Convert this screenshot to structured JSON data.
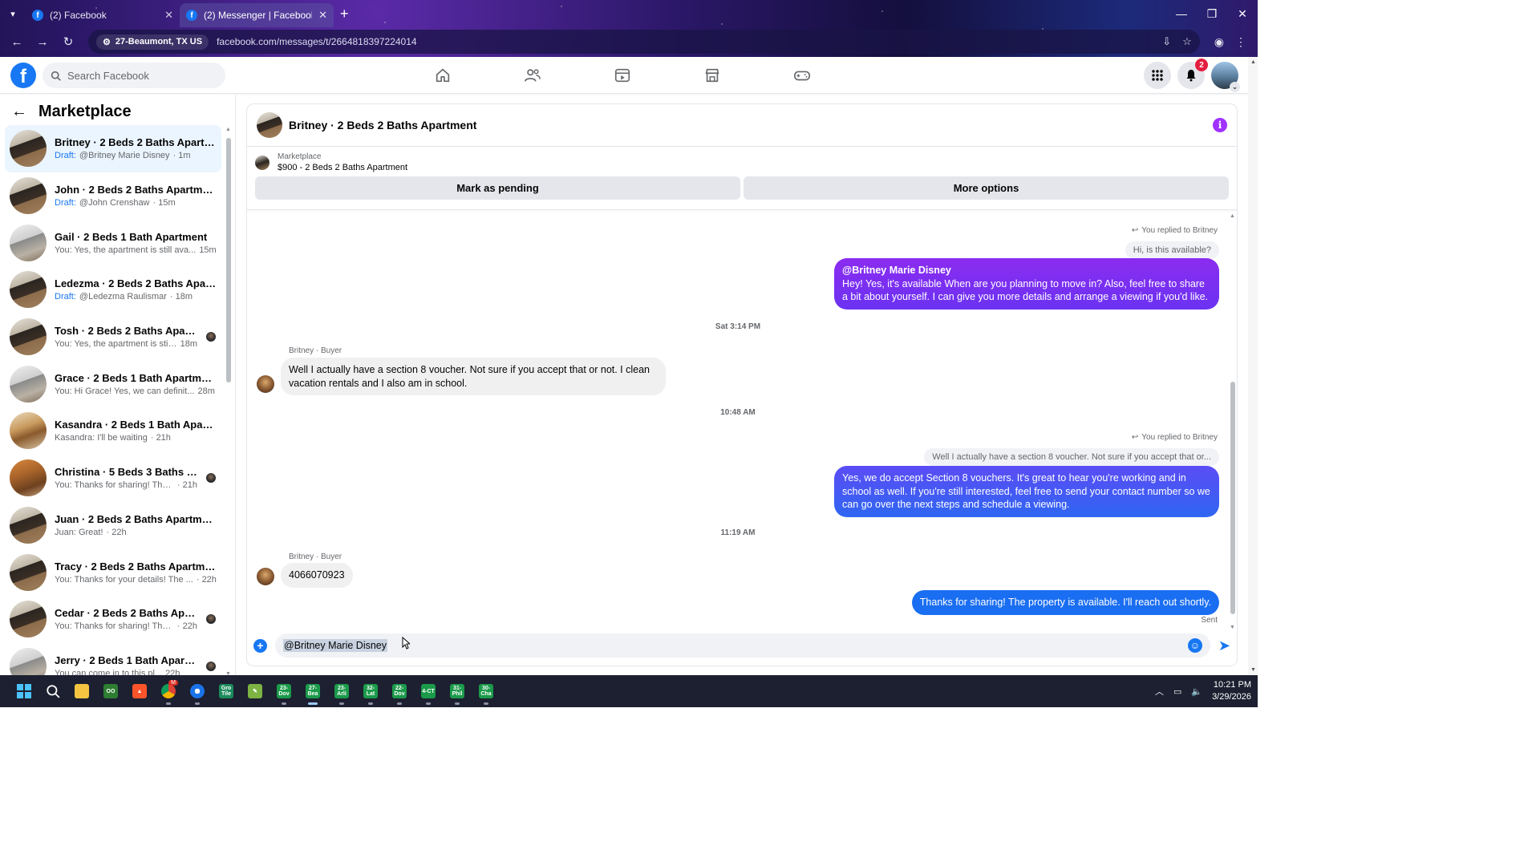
{
  "browser": {
    "tabs": [
      {
        "title": "(2) Facebook",
        "active": false
      },
      {
        "title": "(2) Messenger | Facebook",
        "active": true
      }
    ],
    "location_chip": "27-Beaumont, TX US",
    "url": "facebook.com/messages/t/2664818397224014"
  },
  "facebook": {
    "search_placeholder": "Search Facebook",
    "notification_count": "2"
  },
  "sidebar": {
    "title": "Marketplace",
    "conversations": [
      {
        "title": "Britney · 2 Beds 2 Baths Apartm...",
        "draft": "Draft:",
        "snippet": "@Britney Marie Disney",
        "time": "· 1m",
        "thumb": "t-dark",
        "active": true,
        "seen": false
      },
      {
        "title": "John · 2 Beds 2 Baths Apartment",
        "draft": "Draft:",
        "snippet": "@John Crenshaw",
        "time": "· 15m",
        "thumb": "t-dark",
        "active": false,
        "seen": false
      },
      {
        "title": "Gail · 2 Beds 1 Bath Apartment",
        "draft": "",
        "snippet": "You: Yes, the apartment is still ava...",
        "time": "15m",
        "thumb": "t-grey",
        "active": false,
        "seen": false
      },
      {
        "title": "Ledezma · 2 Beds 2 Baths Apart...",
        "draft": "Draft:",
        "snippet": "@Ledezma Raulismar",
        "time": "· 18m",
        "thumb": "t-dark",
        "active": false,
        "seen": false
      },
      {
        "title": "Tosh · 2 Beds 2 Baths Apartm...",
        "draft": "",
        "snippet": "You: Yes, the apartment is still ...",
        "time": "18m",
        "thumb": "t-dark",
        "active": false,
        "seen": true
      },
      {
        "title": "Grace · 2 Beds 1 Bath Apartment",
        "draft": "",
        "snippet": "You: Hi Grace! Yes, we can definit...",
        "time": "28m",
        "thumb": "t-grey",
        "active": false,
        "seen": false
      },
      {
        "title": "Kasandra · 2 Beds 1 Bath Apartm...",
        "draft": "",
        "snippet": "Kasandra: I'll be waiting",
        "time": "· 21h",
        "thumb": "t-kitchen",
        "active": false,
        "seen": false
      },
      {
        "title": "Christina · 5 Beds 3 Baths Hou...",
        "draft": "",
        "snippet": "You: Thanks for sharing! The pr...",
        "time": "· 21h",
        "thumb": "t-orange",
        "active": false,
        "seen": true
      },
      {
        "title": "Juan · 2 Beds 2 Baths Apartment",
        "draft": "",
        "snippet": "Juan: Great!",
        "time": "· 22h",
        "thumb": "t-dark",
        "active": false,
        "seen": false
      },
      {
        "title": "Tracy · 2 Beds 2 Baths Apartment",
        "draft": "",
        "snippet": "You: Thanks for your details! The ...",
        "time": "· 22h",
        "thumb": "t-dark",
        "active": false,
        "seen": false
      },
      {
        "title": "Cedar · 2 Beds 2 Baths Apart...",
        "draft": "",
        "snippet": "You: Thanks for sharing! The pr...",
        "time": "· 22h",
        "thumb": "t-dark",
        "active": false,
        "seen": true
      },
      {
        "title": "Jerry · 2 Beds 1 Bath Apartment",
        "draft": "",
        "snippet": "You can come in to this pl...",
        "time": "22h",
        "thumb": "t-grey",
        "active": false,
        "seen": true
      }
    ]
  },
  "chat": {
    "title": "Britney · 2 Beds 2 Baths Apartment",
    "listing_label": "Marketplace",
    "listing_price": "$900 - 2 Beds 2 Baths Apartment",
    "mark_pending": "Mark as pending",
    "more_options": "More options",
    "replied_1": "You replied to Britney",
    "quote_1": "Hi, is this available?",
    "msg_1_mention": "@Britney Marie Disney",
    "msg_1_text": "Hey! Yes, it's available  When are you planning to move in? Also, feel free to share a bit about yourself. I can give you more details and arrange a viewing if you'd like.",
    "time_1": "Sat 3:14 PM",
    "sender_1": "Britney · Buyer",
    "msg_2": "Well I actually have a section 8 voucher. Not sure if you accept that or not. I clean vacation rentals and I also am in school.",
    "time_2": "10:48 AM",
    "replied_2": "You replied to Britney",
    "quote_2": "Well I actually have a section 8 voucher. Not sure if you accept that or...",
    "msg_3": "Yes, we do accept Section 8 vouchers. It's great to hear you're working and in school as well. If you're still interested, feel free to send your contact number so we can go over the next steps and schedule a viewing.",
    "time_3": "11:19 AM",
    "sender_2": "Britney · Buyer",
    "msg_4": "4066070923",
    "msg_5": "Thanks for sharing! The property is available. I'll reach out shortly.",
    "sent": "Sent",
    "composer_value": "@Britney Marie Disney"
  },
  "taskbar": {
    "apps": [
      {
        "name": "windows-start",
        "label": ""
      },
      {
        "name": "search",
        "label": ""
      },
      {
        "name": "file-explorer",
        "label": ""
      },
      {
        "name": "app-green-oo",
        "label": "OO"
      },
      {
        "name": "brave",
        "label": ""
      },
      {
        "name": "chrome",
        "label": ""
      },
      {
        "name": "chrome-blue",
        "label": ""
      },
      {
        "name": "app-grotile",
        "label": "Gro Tile"
      },
      {
        "name": "app-notepad",
        "label": ""
      },
      {
        "name": "app-23-dov",
        "label": "23-Dov"
      },
      {
        "name": "app-27-bea",
        "label": "27-Bea"
      },
      {
        "name": "app-23-arli",
        "label": "23-Arli"
      },
      {
        "name": "app-32-lat",
        "label": "32-Lat"
      },
      {
        "name": "app-22-dov",
        "label": "22-Dov"
      },
      {
        "name": "app-4-ct",
        "label": "4-CT"
      },
      {
        "name": "app-31-phil",
        "label": "31-Phil"
      },
      {
        "name": "app-30-cha",
        "label": "30-Cha"
      }
    ],
    "time": "10:21 PM",
    "date": "3/29/2026",
    "chrome_badge": "M"
  }
}
